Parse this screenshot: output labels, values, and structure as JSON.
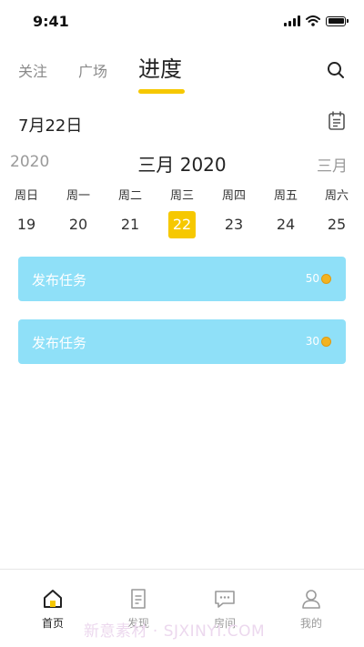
{
  "status_bar": {
    "time": "9:41"
  },
  "tabs": [
    {
      "label": "关注",
      "active": false
    },
    {
      "label": "广场",
      "active": false
    },
    {
      "label": "进度",
      "active": true
    }
  ],
  "date_header": {
    "title": "7月22日"
  },
  "month_nav": {
    "prev": "2020",
    "current": "三月 2020",
    "next": "三月"
  },
  "week": [
    {
      "name": "周日",
      "date": "19",
      "selected": false
    },
    {
      "name": "周一",
      "date": "20",
      "selected": false
    },
    {
      "name": "周二",
      "date": "21",
      "selected": false
    },
    {
      "name": "周三",
      "date": "22",
      "selected": true
    },
    {
      "name": "周四",
      "date": "23",
      "selected": false
    },
    {
      "name": "周五",
      "date": "24",
      "selected": false
    },
    {
      "name": "周六",
      "date": "25",
      "selected": false
    }
  ],
  "tasks": [
    {
      "title": "发布任务",
      "points": "50"
    },
    {
      "title": "发布任务",
      "points": "30"
    }
  ],
  "bottom_nav": [
    {
      "label": "首页",
      "icon": "home-icon",
      "active": true
    },
    {
      "label": "发现",
      "icon": "discover-icon",
      "active": false
    },
    {
      "label": "房间",
      "icon": "chat-icon",
      "active": false
    },
    {
      "label": "我的",
      "icon": "profile-icon",
      "active": false
    }
  ],
  "watermark": "新意素材 · SJXINYI.COM",
  "colors": {
    "accent": "#f6c800",
    "card": "#8fe0f8",
    "coin": "#f2b320"
  }
}
